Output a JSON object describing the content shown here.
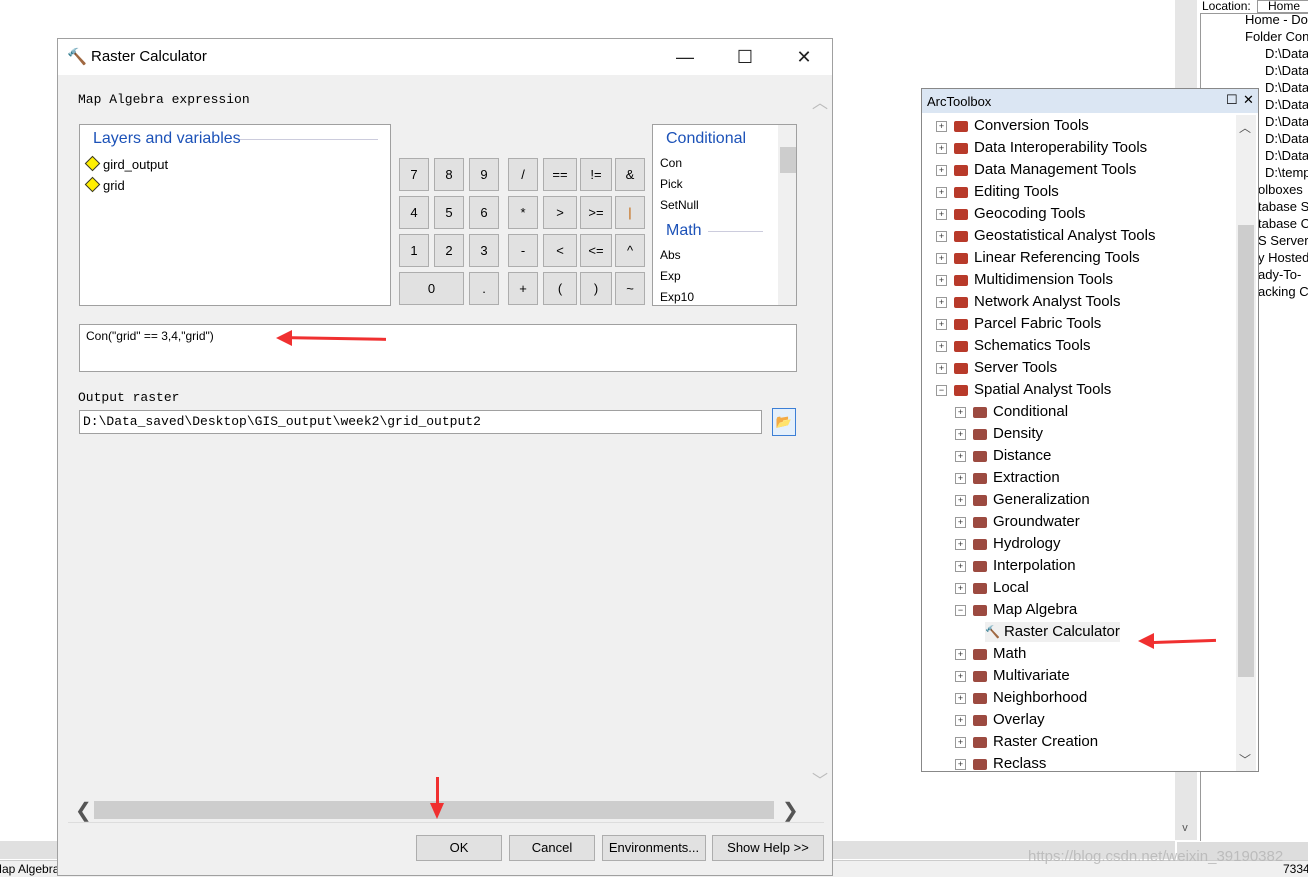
{
  "catalog": {
    "tabs": [
      "Location:",
      "Home"
    ],
    "items": [
      "Home - Do",
      "Folder Con",
      "D:\\Data",
      "D:\\Data",
      "D:\\Data",
      "D:\\Data",
      "D:\\Data",
      "D:\\Data",
      "D:\\Data",
      "D:\\temp",
      "olboxes",
      "tabase S",
      "tabase C",
      "S Server",
      "y Hosted",
      "ady-To-",
      "acking C"
    ]
  },
  "dialog": {
    "title": "Raster Calculator",
    "expression_label": "Map Algebra expression",
    "layers_title": "Layers and variables",
    "layers": [
      "gird_output",
      "grid"
    ],
    "buttons": [
      [
        "7",
        "8",
        "9",
        "/",
        "==",
        "!=",
        "&"
      ],
      [
        "4",
        "5",
        "6",
        "*",
        ">",
        ">=",
        "|"
      ],
      [
        "1",
        "2",
        "3",
        "-",
        "<",
        "<=",
        "^"
      ],
      [
        "0",
        ".",
        "+",
        "(",
        ")",
        "~"
      ]
    ],
    "functions": {
      "conditional_title": "Conditional",
      "conditional": [
        "Con",
        "Pick",
        "SetNull"
      ],
      "math_title": "Math",
      "math": [
        "Abs",
        "Exp",
        "Exp10"
      ]
    },
    "expression": "Con(\"grid\" == 3,4,\"grid\")",
    "output_label": "Output raster",
    "output_value": "D:\\Data_saved\\Desktop\\GIS_output\\week2\\grid_output2",
    "ok": "OK",
    "cancel": "Cancel",
    "environments": "Environments...",
    "show_help": "Show Help >>"
  },
  "toolbox": {
    "title": "ArcToolbox",
    "top": [
      "Conversion Tools",
      "Data Interoperability Tools",
      "Data Management Tools",
      "Editing Tools",
      "Geocoding Tools",
      "Geostatistical Analyst Tools",
      "Linear Referencing Tools",
      "Multidimension Tools",
      "Network Analyst Tools",
      "Parcel Fabric Tools",
      "Schematics Tools",
      "Server Tools",
      "Spatial Analyst Tools"
    ],
    "spatial": [
      "Conditional",
      "Density",
      "Distance",
      "Extraction",
      "Generalization",
      "Groundwater",
      "Hydrology",
      "Interpolation",
      "Local",
      "Map Algebra"
    ],
    "tool": "Raster Calculator",
    "spatial_after": [
      "Math",
      "Multivariate",
      "Neighborhood",
      "Overlay",
      "Raster Creation",
      "Reclass"
    ]
  },
  "status": {
    "left": "Map Algebra",
    "right": "7334"
  },
  "watermark": "https://blog.csdn.net/weixin_39190382"
}
